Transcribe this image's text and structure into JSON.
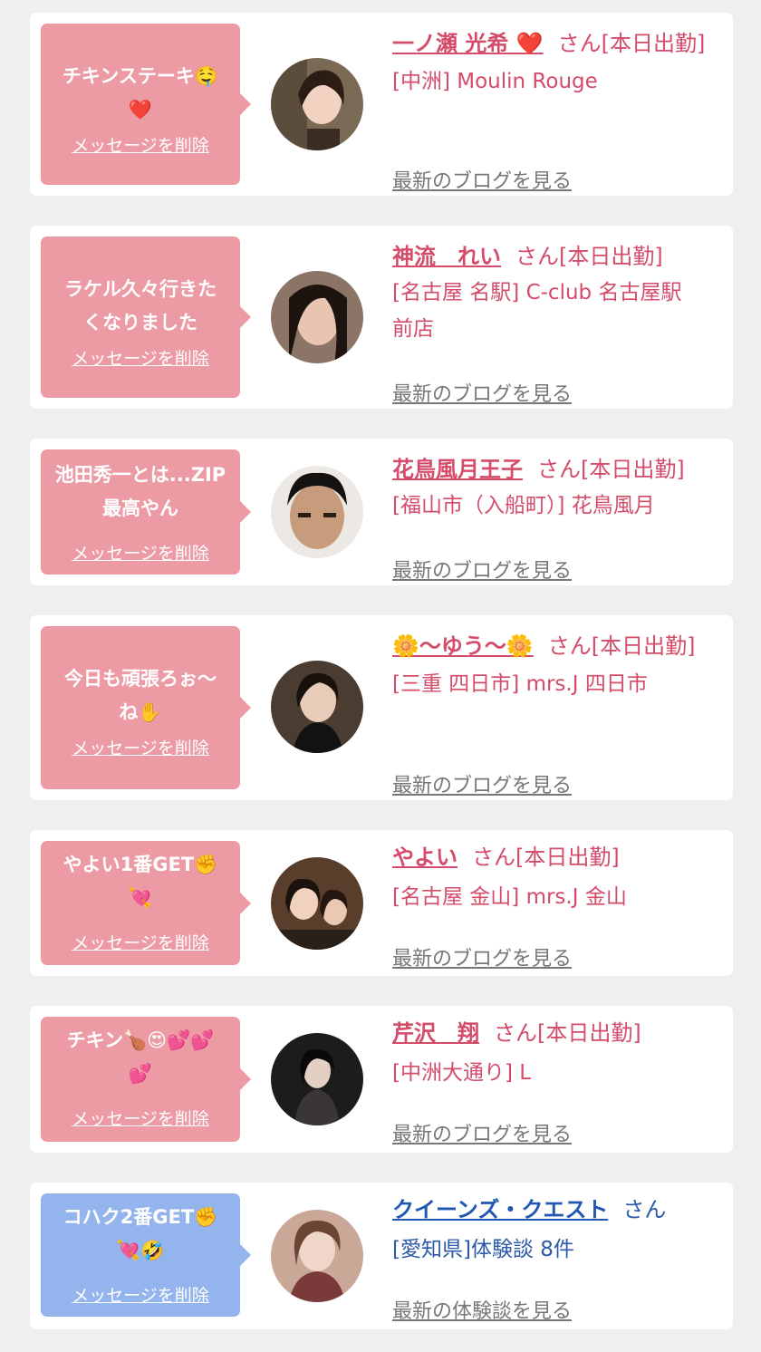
{
  "items": [
    {
      "bubble_color": "pink",
      "message": "チキンステーキ🤤\n❤️",
      "delete_label": "メッセージを削除",
      "name": "一ノ瀬 光希 ❤️",
      "san": "さん[本日出勤]",
      "shop": "[中洲] Moulin Rouge",
      "blog_link": "最新のブログを見る",
      "avatar_bg": "#7a6a55"
    },
    {
      "bubble_color": "pink",
      "message": "ラケル久々行きた\nくなりました",
      "delete_label": "メッセージを削除",
      "name": "神流　れい",
      "san": "さん[本日出勤]",
      "shop": "[名古屋 名駅] C-club 名古屋駅\n前店",
      "blog_link": "最新のブログを見る",
      "avatar_bg": "#8c7466"
    },
    {
      "bubble_color": "pink",
      "message": "池田秀一とは...ZIP\n最高やん",
      "delete_label": "メッセージを削除",
      "name": "花鳥風月王子",
      "san": "さん[本日出勤]",
      "shop": "[福山市（入船町）] 花鳥風月",
      "blog_link": "最新のブログを見る",
      "avatar_bg": "#d8d4cf"
    },
    {
      "bubble_color": "pink",
      "message": "今日も頑張ろぉ〜\nね✋",
      "delete_label": "メッセージを削除",
      "name": "🌼〜ゆう〜🌼",
      "san": "さん[本日出勤]",
      "shop": "[三重 四日市] mrs.J 四日市",
      "blog_link": "最新のブログを見る",
      "avatar_bg": "#4a3c30"
    },
    {
      "bubble_color": "pink",
      "message": "やよい1番GET✊\n💘",
      "delete_label": "メッセージを削除",
      "name": "やよい",
      "san": "さん[本日出勤]",
      "shop": "[名古屋 金山] mrs.J 金山",
      "blog_link": "最新のブログを見る",
      "avatar_bg": "#5a3e2c"
    },
    {
      "bubble_color": "pink",
      "message": "チキン🍗😍💕💕\n💕",
      "delete_label": "メッセージを削除",
      "name": "芹沢　翔",
      "san": "さん[本日出勤]",
      "shop": "[中洲大通り] L",
      "blog_link": "最新のブログを見る",
      "avatar_bg": "#1c1c1c"
    },
    {
      "bubble_color": "blue",
      "message": "コハク2番GET✊\n💘🤣",
      "delete_label": "メッセージを削除",
      "name": "クイーンズ・クエスト",
      "san": "さん",
      "shop": "[愛知県]体験談 8件",
      "blog_link": "最新の体験談を見る",
      "avatar_bg": "#c9a898"
    }
  ],
  "colors": {
    "page_bg": "#efefef",
    "pink_bubble": "#ec9aa4",
    "blue_bubble": "#93b4ec",
    "pink_text": "#d44c6a",
    "blue_text": "#1f57b3",
    "link_gray": "#777777"
  }
}
